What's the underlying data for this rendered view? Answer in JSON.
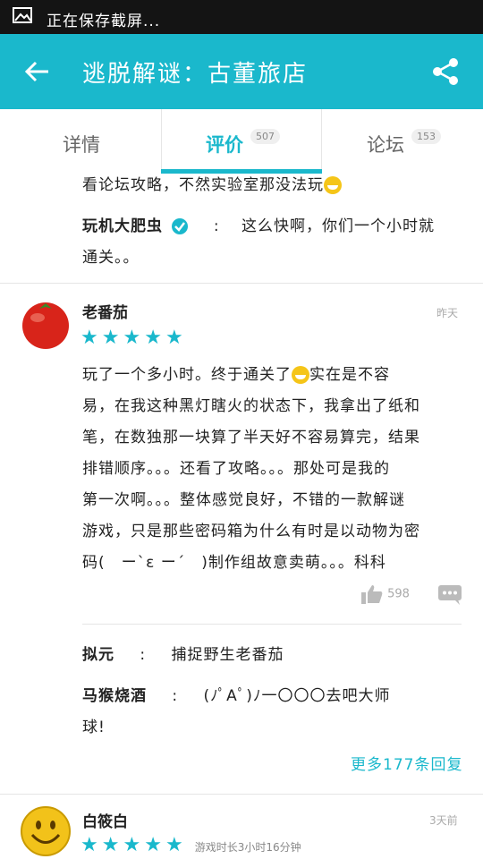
{
  "status_bar": {
    "text": "正在保存截屏..."
  },
  "app_bar": {
    "title": "逃脱解谜：古董旅店"
  },
  "tabs": [
    {
      "label": "详情",
      "count": ""
    },
    {
      "label": "评价",
      "count": "507"
    },
    {
      "label": "论坛",
      "count": "153"
    }
  ],
  "prev_review": {
    "text_tail": "看论坛攻略，不然实验室那没法玩",
    "reply": {
      "user": "玩机大肥虫",
      "sep": ":",
      "line1": "这么快啊，你们一个小时就",
      "line2": "通关。。"
    }
  },
  "review1": {
    "user": "老番茄",
    "time": "昨天",
    "stars": 5,
    "lines": [
      "玩了一个多小时。终于通关了",
      "实在是不容",
      "易，在我这种黑灯瞎火的状态下，我拿出了纸和",
      "笔，在数独那一块算了半天好不容易算完，结果",
      "排错顺序。。。还看了攻略。。。那处可是我的",
      "第一次啊。。。整体感觉良好，不错的一款解谜",
      "游戏，只是那些密码箱为什么有时是以动物为密",
      "码(　ー`ε ー´　)制作组故意卖萌。。。科科"
    ],
    "likes": "598",
    "replies": [
      {
        "user": "拟元",
        "sep": ":",
        "text": "捕捉野生老番茄"
      },
      {
        "user": "马猴烧酒",
        "sep": ":",
        "line1": "(ﾉﾟΑﾟ)ﾉ一〇〇〇去吧大师",
        "line2": "球!"
      }
    ],
    "more_replies": "更多177条回复"
  },
  "review2": {
    "user": "白筱白",
    "time": "3天前",
    "stars": 5,
    "playtime": "游戏时长3小时16分钟"
  },
  "colors": {
    "accent": "#1ab8cc",
    "status_bar": "#141414"
  }
}
